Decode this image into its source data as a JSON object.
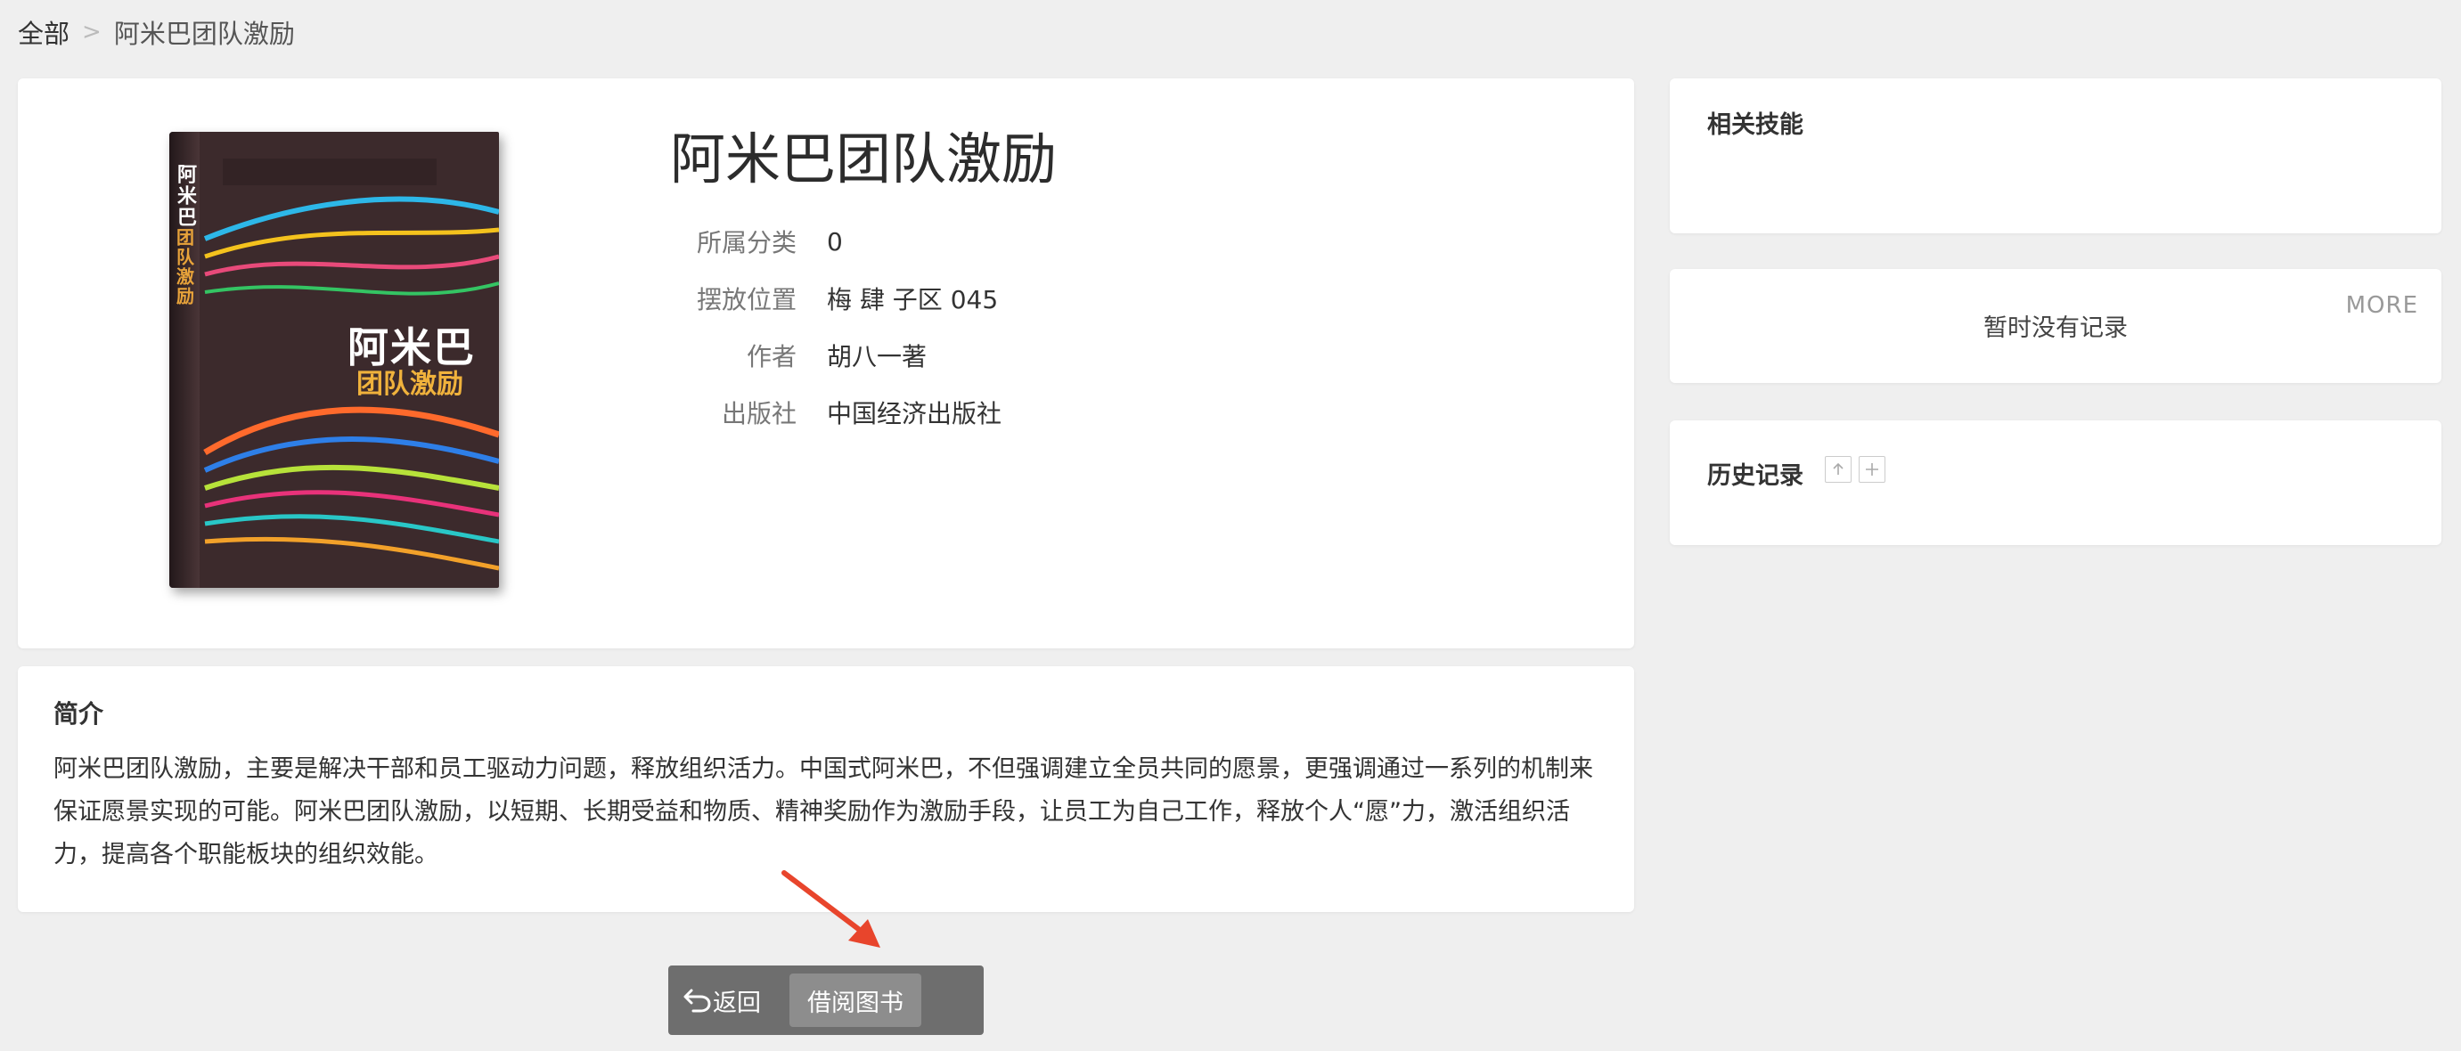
{
  "breadcrumb": {
    "root": "全部",
    "separator": ">",
    "current": "阿米巴团队激励"
  },
  "book": {
    "title": "阿米巴团队激励",
    "cover": {
      "title": "阿米巴",
      "subtitle": "团队激励",
      "spine_title": "阿米巴",
      "spine_subtitle": "团队激励"
    },
    "meta": [
      {
        "label": "所属分类",
        "value": "0"
      },
      {
        "label": "摆放位置",
        "value": "梅 肆 子区 045"
      },
      {
        "label": "作者",
        "value": "胡八一著"
      },
      {
        "label": "出版社",
        "value": "中国经济出版社"
      }
    ]
  },
  "intro": {
    "title": "简介",
    "text": "阿米巴团队激励，主要是解决干部和员工驱动力问题，释放组织活力。中国式阿米巴，不但强调建立全员共同的愿景，更强调通过一系列的机制来保证愿景实现的可能。阿米巴团队激励，以短期、长期受益和物质、精神奖励作为激励手段，让员工为自己工作，释放个人“愿”力，激活组织活力，提高各个职能板块的组织效能。"
  },
  "skills": {
    "title": "相关技能"
  },
  "records": {
    "empty_text": "暂时没有记录",
    "more_label": "MORE"
  },
  "history": {
    "title": "历史记录"
  },
  "actions": {
    "back_label": "返回",
    "borrow_label": "借阅图书"
  },
  "colors": {
    "annotation_arrow": "#e8452c",
    "button_bar": "#6e6e6e"
  }
}
